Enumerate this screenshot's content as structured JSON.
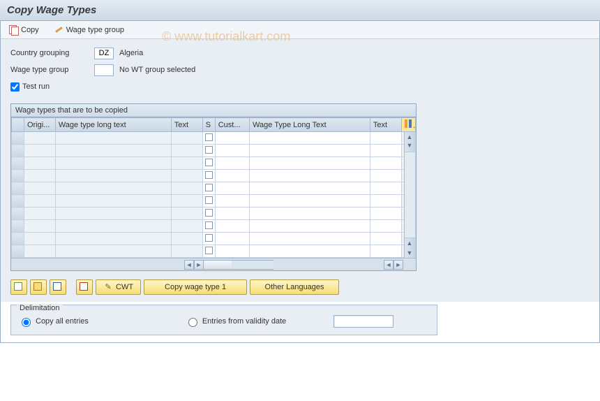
{
  "title": "Copy Wage Types",
  "watermark": "©   www.tutorialkart.com",
  "toolbar": {
    "copy_label": "Copy",
    "wage_group_label": "Wage type group"
  },
  "form": {
    "country_label": "Country grouping",
    "country_code": "DZ",
    "country_name": "Algeria",
    "wage_group_label": "Wage type group",
    "wage_group_code": "",
    "wage_group_text": "No WT group selected",
    "test_run_label": "Test run",
    "test_run_checked": true
  },
  "table": {
    "title": "Wage types that are to be copied",
    "cols": {
      "origi": "Origi...",
      "wlt": "Wage type long text",
      "text": "Text",
      "s": "S",
      "cust": "Cust...",
      "wlt2": "Wage Type Long Text",
      "text2": "Text"
    },
    "row_count": 10
  },
  "buttons": {
    "cwt": "CWT",
    "copy1": "Copy wage type 1",
    "other_lang": "Other Languages"
  },
  "delimitation": {
    "legend": "Delimitation",
    "copy_all": "Copy all entries",
    "entries_from": "Entries from validity date",
    "date_value": ""
  }
}
